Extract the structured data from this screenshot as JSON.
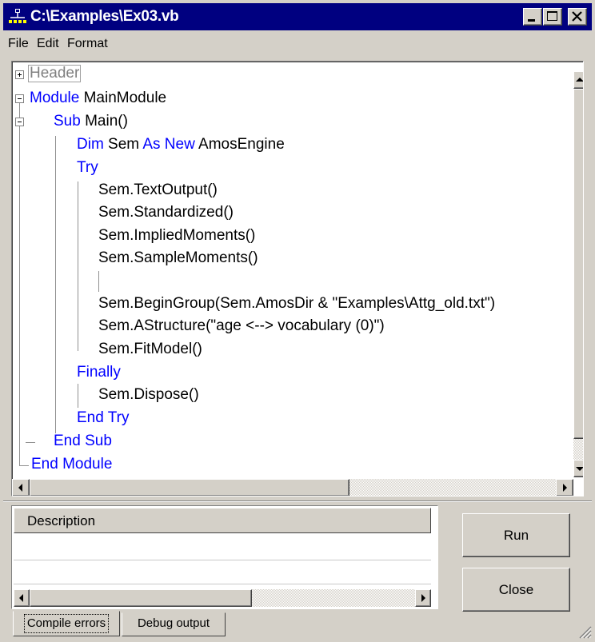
{
  "window": {
    "title": "C:\\Examples\\Ex03.vb"
  },
  "menu": {
    "file": "File",
    "edit": "Edit",
    "format": "Format"
  },
  "code": {
    "header": "Header",
    "module_kw": "Module",
    "module_name": " MainModule",
    "sub_kw": "Sub",
    "sub_name": " Main()",
    "dim_kw": "Dim",
    "dim_mid": " Sem ",
    "as_new_kw": "As New",
    "dim_type": " AmosEngine",
    "try_kw": "Try",
    "line_textoutput": "Sem.TextOutput()",
    "line_standardized": "Sem.Standardized()",
    "line_implied": "Sem.ImpliedMoments()",
    "line_sample": "Sem.SampleMoments()",
    "line_begingroup": "Sem.BeginGroup(Sem.AmosDir & \"Examples\\Attg_old.txt\")",
    "line_astructure": "Sem.AStructure(\"age <--> vocabulary (0)\")",
    "line_fitmodel": "Sem.FitModel()",
    "finally_kw": "Finally",
    "line_dispose": "Sem.Dispose()",
    "end_try_kw": "End Try",
    "end_sub_kw": "End Sub",
    "end_module_kw": "End Module"
  },
  "errors_panel": {
    "column_header": "Description"
  },
  "buttons": {
    "run": "Run",
    "close": "Close"
  },
  "tabs": {
    "compile_errors": "Compile errors",
    "debug_output": "Debug output"
  },
  "colors": {
    "titlebar": "#000080",
    "keyword": "#0000ff",
    "face": "#d4d0c8"
  },
  "icons": [
    "app-icon",
    "minimize-icon",
    "maximize-icon",
    "close-icon",
    "fold-plus-icon",
    "fold-minus-icon",
    "scroll-up-icon",
    "scroll-down-icon",
    "scroll-left-icon",
    "scroll-right-icon",
    "size-grip-icon"
  ]
}
